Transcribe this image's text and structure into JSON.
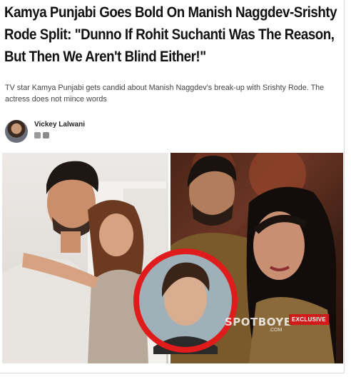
{
  "article": {
    "headline": "Kamya Punjabi Goes Bold On Manish Naggdev-Srishty Rode Split: \"Dunno If Rohit Suchanti Was The Reason, But Then We Aren't Blind Either!\"",
    "subheadline": "TV star Kamya Punjabi gets candid about Manish Naggdev's break-up with Srishty Rode. The actress does not mince words",
    "author": {
      "name": "Vickey Lalwani",
      "share_icons": [
        "share-icon",
        "email-icon"
      ]
    },
    "image": {
      "watermark": "SPOTBOYE",
      "watermark_sub": ".COM",
      "badge": "EXCLUSIVE"
    }
  },
  "colors": {
    "headline": "#111111",
    "badge_bg": "#d11a1a",
    "circle_ring": "#e01b1b"
  }
}
